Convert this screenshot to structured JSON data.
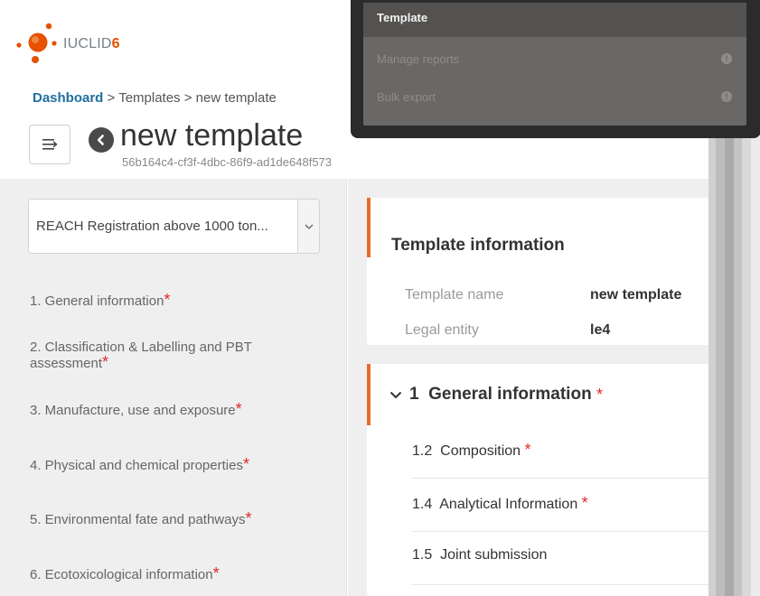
{
  "app": {
    "logo_text": "IUCLID",
    "logo_version": "6"
  },
  "breadcrumb": {
    "items": [
      "Dashboard",
      "Templates",
      "new template"
    ],
    "separator": " > "
  },
  "page": {
    "title": "new template",
    "uuid": "56b164c4-cf3f-4dbc-86f9-ad1de648f573"
  },
  "left_panel": {
    "type_select": {
      "value": "REACH Registration above 1000 ton..."
    },
    "nav_items": [
      {
        "label": "1. General information",
        "required": true
      },
      {
        "label": "2. Classification & Labelling and PBT assessment",
        "required": true
      },
      {
        "label": "3. Manufacture, use and exposure",
        "required": true
      },
      {
        "label": "4. Physical and chemical properties",
        "required": true
      },
      {
        "label": "5. Environmental fate and pathways",
        "required": true
      },
      {
        "label": "6. Ecotoxicological information",
        "required": true
      }
    ],
    "required_marker": "*"
  },
  "template_info": {
    "title": "Template information",
    "fields": [
      {
        "label": "Template name",
        "value": "new template"
      },
      {
        "label": "Legal entity",
        "value": "le4"
      }
    ]
  },
  "section": {
    "number": "1",
    "title": "General information",
    "required": true,
    "items": [
      {
        "label": "1.2  Composition",
        "required": true
      },
      {
        "label": "1.4  Analytical Information",
        "required": true
      },
      {
        "label": "1.5  Joint submission",
        "required": false
      }
    ]
  },
  "overlay_menu": {
    "items": [
      {
        "label": "Template",
        "active": true,
        "has_info": false
      },
      {
        "label": "Manage reports",
        "active": false,
        "has_info": true
      },
      {
        "label": "Bulk export",
        "active": false,
        "has_info": true
      }
    ]
  },
  "colors": {
    "accent": "#e9692c",
    "brand": "#e65100",
    "link": "#1f6f9f",
    "required": "#e0292b",
    "panel_bg": "#efefef"
  },
  "icons": {
    "menu": "menu-collapse-icon",
    "back": "back-arrow-icon",
    "select_arrow": "chevron-down-icon",
    "section_chevron": "chevron-down-icon",
    "info": "info-icon"
  }
}
